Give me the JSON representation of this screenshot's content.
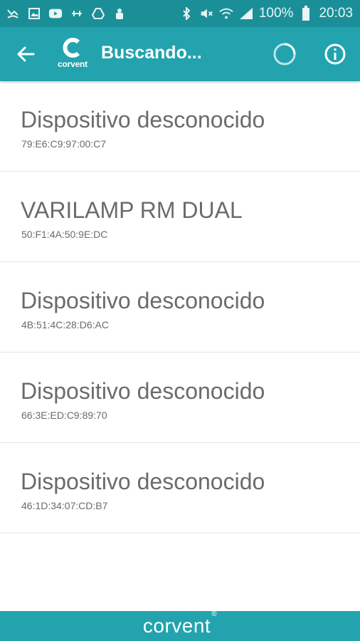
{
  "status_bar": {
    "battery_text": "100%",
    "time": "20:03",
    "left_icons": [
      "missed-call-icon",
      "gallery-icon",
      "youtube-icon",
      "tools-icon",
      "drive-icon",
      "hand-icon"
    ],
    "right_icons": [
      "bluetooth-icon",
      "mute-icon",
      "wifi-icon",
      "signal-icon",
      "battery-icon"
    ]
  },
  "app_bar": {
    "title": "Buscando...",
    "logo_text": "corvent",
    "back_icon": "arrow-back-icon",
    "spinner_icon": "loading-spinner-icon",
    "info_icon": "info-icon"
  },
  "devices": [
    {
      "name": "Dispositivo desconocido",
      "mac": "79:E6:C9:97:00:C7"
    },
    {
      "name": "VARILAMP RM DUAL",
      "mac": "50:F1:4A:50:9E:DC"
    },
    {
      "name": "Dispositivo desconocido",
      "mac": "4B:51:4C:28:D6:AC"
    },
    {
      "name": "Dispositivo desconocido",
      "mac": "66:3E:ED:C9:89:70"
    },
    {
      "name": "Dispositivo desconocido",
      "mac": "46:1D:34:07:CD:B7"
    }
  ],
  "footer": {
    "brand": "corvent",
    "reg_mark": "®"
  },
  "colors": {
    "status_bar": "#1b8f98",
    "app_bar": "#22a3ad",
    "list_text": "#6b6b6b",
    "divider": "#e4e4e4"
  }
}
